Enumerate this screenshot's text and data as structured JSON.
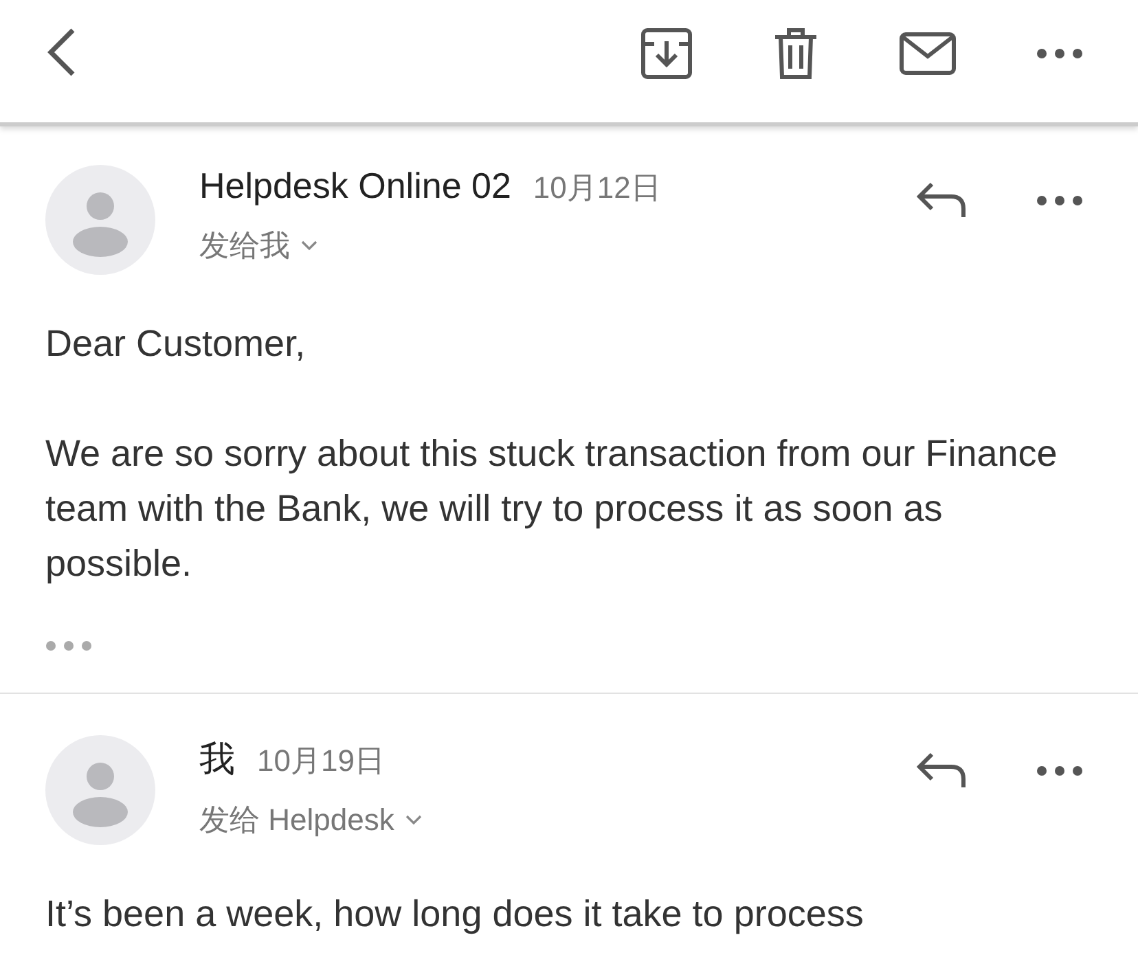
{
  "messages": [
    {
      "sender": "Helpdesk Online 02",
      "date": "10月12日",
      "recipient": "发给我",
      "paragraphs": [
        "Dear Customer,",
        "We are so sorry about this stuck transaction from our Finance team with the Bank, we will try to process it as soon as possible."
      ],
      "has_more": true
    },
    {
      "sender": "我",
      "date": "10月19日",
      "recipient": "发给 Helpdesk",
      "paragraphs": [
        "It’s been a week, how long does it take to process"
      ],
      "has_more": false
    }
  ]
}
